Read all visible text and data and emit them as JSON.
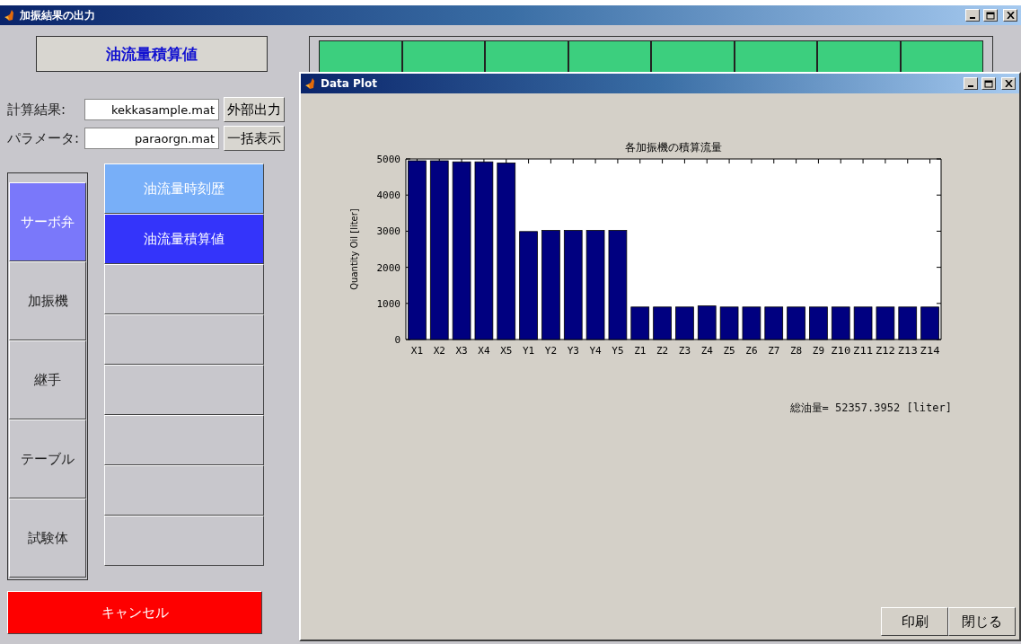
{
  "window": {
    "title": "加振結果の出力"
  },
  "header": {
    "label": "油流量積算値"
  },
  "status_cells": [
    {
      "lit": true
    },
    {
      "lit": true
    },
    {
      "lit": true
    },
    {
      "lit": true
    },
    {
      "lit": true
    },
    {
      "lit": true
    },
    {
      "lit": true
    },
    {
      "lit": true
    }
  ],
  "fields": [
    {
      "label": "計算結果:",
      "value": "kekkasample.mat",
      "button": "外部出力"
    },
    {
      "label": "パラメータ:",
      "value": "paraorgn.mat",
      "button": "一括表示"
    }
  ],
  "categories": [
    {
      "label": "サーボ弁",
      "selected": true
    },
    {
      "label": "加振機",
      "selected": false
    },
    {
      "label": "継手",
      "selected": false
    },
    {
      "label": "テーブル",
      "selected": false
    },
    {
      "label": "試験体",
      "selected": false
    }
  ],
  "outputs": [
    {
      "kind": "item",
      "label": "油流量時刻歴",
      "selected": false
    },
    {
      "kind": "item",
      "label": "油流量積算値",
      "selected": true
    },
    {
      "kind": "blank"
    },
    {
      "kind": "blank"
    },
    {
      "kind": "blank"
    },
    {
      "kind": "blank"
    },
    {
      "kind": "blank"
    },
    {
      "kind": "blank"
    }
  ],
  "cancel_button": "キャンセル",
  "plot_window": {
    "title": "Data Plot",
    "chart_data": {
      "type": "bar",
      "title": "各加振機の積算流量",
      "ylabel": "Quantity Oil [liter]",
      "categories": [
        "X1",
        "X2",
        "X3",
        "X4",
        "X5",
        "Y1",
        "Y2",
        "Y3",
        "Y4",
        "Y5",
        "Z1",
        "Z2",
        "Z3",
        "Z4",
        "Z5",
        "Z6",
        "Z7",
        "Z8",
        "Z9",
        "Z10",
        "Z11",
        "Z12",
        "Z13",
        "Z14"
      ],
      "series": [
        {
          "color": "#000080",
          "values": [
            4950,
            4950,
            4920,
            4920,
            4890,
            2990,
            3020,
            3020,
            3020,
            3020,
            900,
            900,
            900,
            930,
            900,
            900,
            900,
            900,
            900,
            900,
            900,
            900,
            900,
            900
          ]
        }
      ],
      "ylim": [
        0,
        5000
      ],
      "yticks": [
        0,
        1000,
        2000,
        3000,
        4000,
        5000
      ]
    },
    "total": "総油量= 52357.3952 [liter]",
    "buttons": [
      "印刷",
      "閉じる"
    ]
  }
}
